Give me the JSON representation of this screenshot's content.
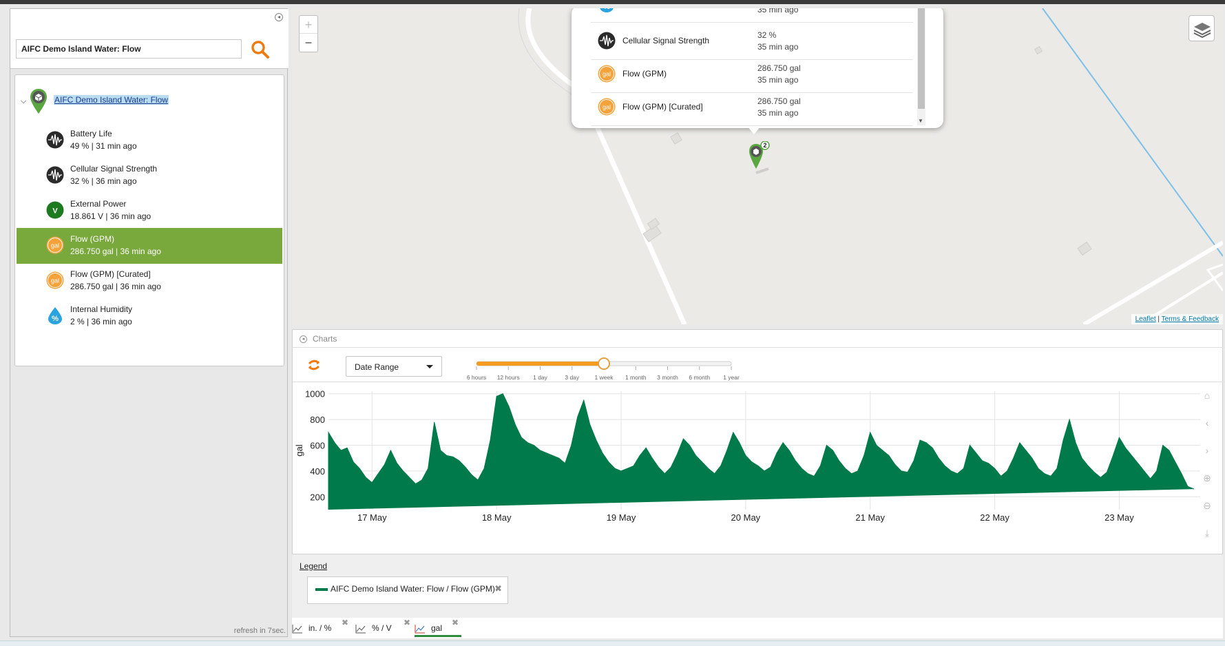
{
  "search": {
    "value": "AIFC Demo Island Water: Flow"
  },
  "tree": {
    "root_label": "AIFC Demo Island Water: Flow",
    "items": [
      {
        "name": "Battery Life",
        "detail": "49 % | 31 min ago",
        "icon": "signal-wave-icon",
        "active": false
      },
      {
        "name": "Cellular Signal Strength",
        "detail": "32 % | 36 min ago",
        "icon": "signal-wave-icon",
        "active": false
      },
      {
        "name": "External Power",
        "detail": "18.861 V | 36 min ago",
        "icon": "voltage-icon",
        "active": false
      },
      {
        "name": "Flow (GPM)",
        "detail": "286.750 gal | 36 min ago",
        "icon": "gallon-icon",
        "active": true
      },
      {
        "name": "Flow (GPM) [Curated]",
        "detail": "286.750 gal | 36 min ago",
        "icon": "gallon-icon",
        "active": false
      },
      {
        "name": "Internal Humidity",
        "detail": "2 % | 36 min ago",
        "icon": "humidity-drop-icon",
        "active": false
      }
    ],
    "refresh_text": "refresh in 7sec."
  },
  "map": {
    "zoom_in": "+",
    "zoom_out": "−",
    "attribution_leaflet": "Leaflet",
    "attribution_sep": " | ",
    "attribution_terms": "Terms & Feedback",
    "marker_badge": "2",
    "popup_rows": [
      {
        "name": "",
        "v1": "",
        "v2": "35 min ago",
        "icon": "humidity-drop-icon"
      },
      {
        "name": "Cellular Signal Strength",
        "v1": "32 %",
        "v2": "35 min ago",
        "icon": "signal-wave-icon"
      },
      {
        "name": "Flow (GPM)",
        "v1": "286.750 gal",
        "v2": "35 min ago",
        "icon": "gallon-icon"
      },
      {
        "name": "Flow (GPM) [Curated]",
        "v1": "286.750 gal",
        "v2": "35 min ago",
        "icon": "gallon-icon"
      }
    ]
  },
  "charts": {
    "title": "Charts",
    "date_range_label": "Date Range",
    "slider_ticks": [
      "6 hours",
      "12 hours",
      "1 day",
      "3 day",
      "1 week",
      "1 month",
      "3 month",
      "6 month",
      "1 year"
    ],
    "slider_selected": "1 week",
    "colors": {
      "series": "#007a4a",
      "slider": "#f39c1f",
      "active_row": "#79a83c"
    }
  },
  "chart_data": {
    "type": "area",
    "xlabel": "",
    "ylabel": "gal",
    "ylim": [
      100,
      1020
    ],
    "yticks": [
      200,
      400,
      600,
      800,
      1000
    ],
    "x_tick_labels": [
      "17 May",
      "18 May",
      "19 May",
      "20 May",
      "21 May",
      "22 May",
      "23 May"
    ],
    "x_range_days": [
      16.65,
      23.65
    ],
    "grid": true,
    "series": [
      {
        "name": "AIFC Demo Island Water: Flow / Flow (GPM)",
        "x_day": [
          16.65,
          16.7,
          16.75,
          16.8,
          16.85,
          16.9,
          16.95,
          17.0,
          17.05,
          17.1,
          17.15,
          17.2,
          17.25,
          17.3,
          17.35,
          17.4,
          17.45,
          17.5,
          17.55,
          17.6,
          17.65,
          17.7,
          17.75,
          17.8,
          17.85,
          17.9,
          17.95,
          18.0,
          18.05,
          18.1,
          18.15,
          18.2,
          18.25,
          18.3,
          18.35,
          18.4,
          18.45,
          18.5,
          18.55,
          18.6,
          18.65,
          18.7,
          18.75,
          18.8,
          18.85,
          18.9,
          18.95,
          19.0,
          19.05,
          19.1,
          19.15,
          19.2,
          19.25,
          19.3,
          19.35,
          19.4,
          19.45,
          19.5,
          19.55,
          19.6,
          19.65,
          19.7,
          19.75,
          19.8,
          19.85,
          19.9,
          19.95,
          20.0,
          20.05,
          20.1,
          20.15,
          20.2,
          20.25,
          20.3,
          20.35,
          20.4,
          20.45,
          20.5,
          20.55,
          20.6,
          20.65,
          20.7,
          20.75,
          20.8,
          20.85,
          20.9,
          20.95,
          21.0,
          21.05,
          21.1,
          21.15,
          21.2,
          21.25,
          21.3,
          21.35,
          21.4,
          21.45,
          21.5,
          21.55,
          21.6,
          21.65,
          21.7,
          21.75,
          21.8,
          21.85,
          21.9,
          21.95,
          22.0,
          22.05,
          22.1,
          22.15,
          22.2,
          22.25,
          22.3,
          22.35,
          22.4,
          22.45,
          22.5,
          22.55,
          22.6,
          22.65,
          22.7,
          22.75,
          22.8,
          22.85,
          22.9,
          22.95,
          23.0,
          23.05,
          23.1,
          23.15,
          23.2,
          23.25,
          23.3,
          23.35,
          23.4,
          23.45,
          23.5,
          23.55,
          23.6,
          23.65
        ],
        "values": [
          700,
          620,
          560,
          580,
          470,
          420,
          350,
          310,
          380,
          450,
          560,
          460,
          400,
          350,
          300,
          330,
          420,
          780,
          560,
          520,
          510,
          480,
          430,
          370,
          330,
          420,
          640,
          980,
          1000,
          900,
          760,
          660,
          620,
          600,
          560,
          540,
          520,
          500,
          460,
          600,
          820,
          950,
          760,
          640,
          540,
          470,
          420,
          400,
          420,
          440,
          520,
          580,
          500,
          430,
          380,
          430,
          530,
          650,
          600,
          520,
          470,
          420,
          380,
          440,
          560,
          700,
          620,
          520,
          470,
          440,
          400,
          430,
          540,
          620,
          560,
          480,
          420,
          380,
          360,
          440,
          600,
          560,
          480,
          420,
          380,
          400,
          520,
          700,
          600,
          560,
          520,
          450,
          400,
          390,
          480,
          640,
          620,
          580,
          500,
          440,
          400,
          380,
          420,
          600,
          540,
          480,
          460,
          420,
          360,
          400,
          500,
          620,
          560,
          500,
          420,
          380,
          360,
          420,
          640,
          800,
          620,
          500,
          440,
          390,
          350,
          390,
          520,
          660,
          580,
          520,
          460,
          400,
          340,
          400,
          600,
          560,
          470,
          380,
          280,
          260
        ]
      }
    ]
  },
  "legend": {
    "title": "Legend",
    "entries": [
      {
        "label": "AIFC Demo Island Water: Flow / Flow (GPM)",
        "color": "#007a4a"
      }
    ]
  },
  "tabs": [
    {
      "label": "in. / %",
      "active": false
    },
    {
      "label": "% / V",
      "active": false
    },
    {
      "label": "gal",
      "active": true
    }
  ]
}
